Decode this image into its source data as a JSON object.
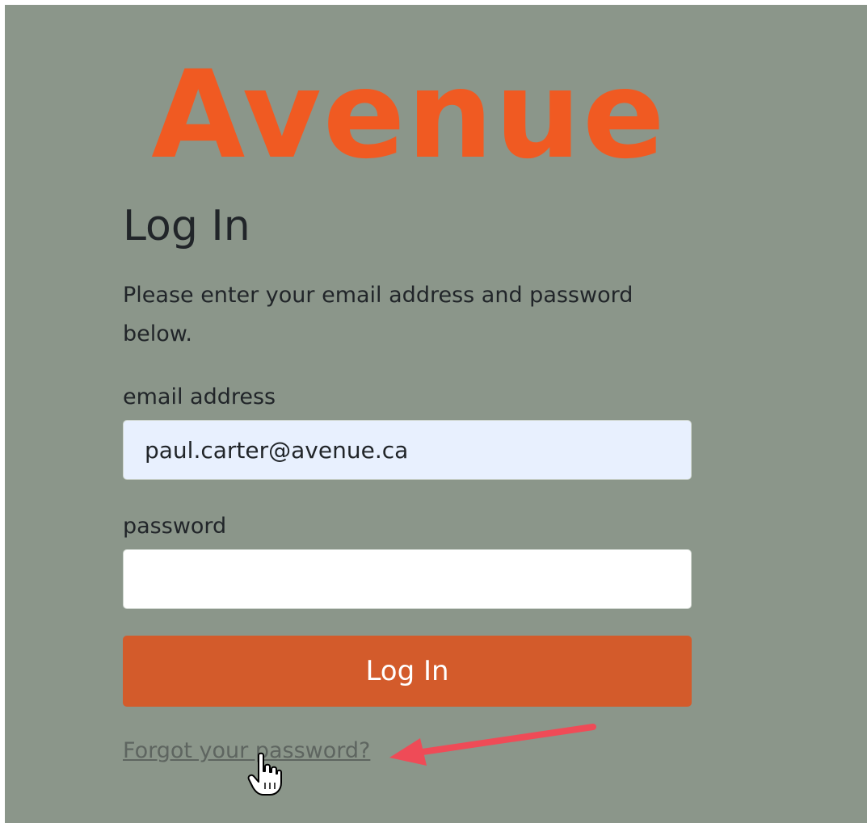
{
  "brand": {
    "logo_text": "Avenue",
    "logo_color": "#f05a22"
  },
  "login": {
    "title": "Log In",
    "instructions": "Please enter your email address and password below.",
    "email_label": "email address",
    "email_value": "paul.carter@avenue.ca",
    "password_label": "password",
    "password_value": "",
    "submit_label": "Log In",
    "forgot_link": "Forgot your password?"
  },
  "annotation": {
    "arrow_color": "#ef4b57",
    "arrow_icon": "red-arrow-icon",
    "cursor_icon": "hand-pointer-icon"
  },
  "colors": {
    "background": "#8b968a",
    "button": "#d35b2b",
    "autofill_field": "#e8f0fe",
    "text": "#212529"
  }
}
